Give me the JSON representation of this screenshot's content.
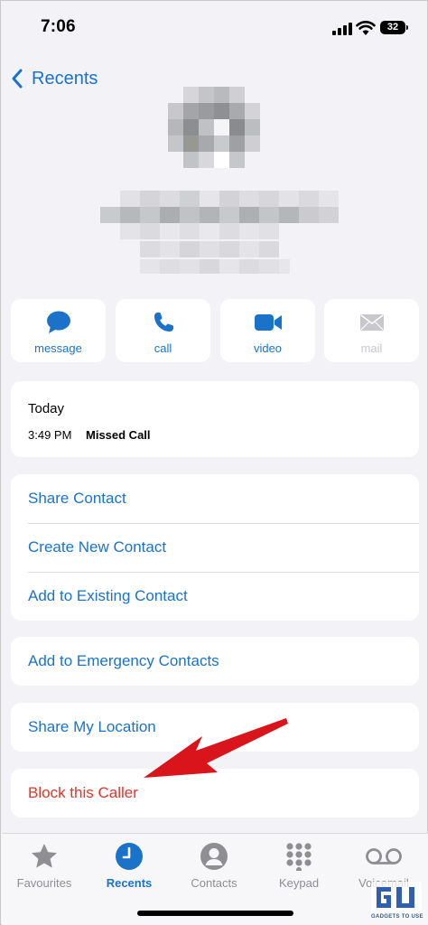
{
  "status_bar": {
    "time": "7:06",
    "battery": "32"
  },
  "nav": {
    "back_label": "Recents"
  },
  "actions": [
    {
      "label": "message",
      "icon": "message-bubble-icon",
      "enabled": true
    },
    {
      "label": "call",
      "icon": "phone-icon",
      "enabled": true
    },
    {
      "label": "video",
      "icon": "video-camera-icon",
      "enabled": true
    },
    {
      "label": "mail",
      "icon": "envelope-icon",
      "enabled": false
    }
  ],
  "call_history": {
    "title": "Today",
    "entries": [
      {
        "time": "3:49 PM",
        "type": "Missed Call"
      }
    ]
  },
  "contact_options": [
    "Share Contact",
    "Create New Contact",
    "Add to Existing Contact"
  ],
  "emergency": {
    "label": "Add to Emergency Contacts"
  },
  "location": {
    "label": "Share My Location"
  },
  "block": {
    "label": "Block this Caller"
  },
  "tabs": [
    {
      "label": "Favourites",
      "icon": "star-icon",
      "active": false
    },
    {
      "label": "Recents",
      "icon": "clock-icon",
      "active": true
    },
    {
      "label": "Contacts",
      "icon": "person-icon",
      "active": false
    },
    {
      "label": "Keypad",
      "icon": "keypad-icon",
      "active": false
    },
    {
      "label": "Voicemail",
      "icon": "voicemail-icon",
      "active": false
    }
  ],
  "watermark": {
    "text": "GADGETS TO USE"
  },
  "colors": {
    "accent": "#1a73c9",
    "destructive": "#e0352b",
    "annotation_arrow": "#d9141b"
  }
}
